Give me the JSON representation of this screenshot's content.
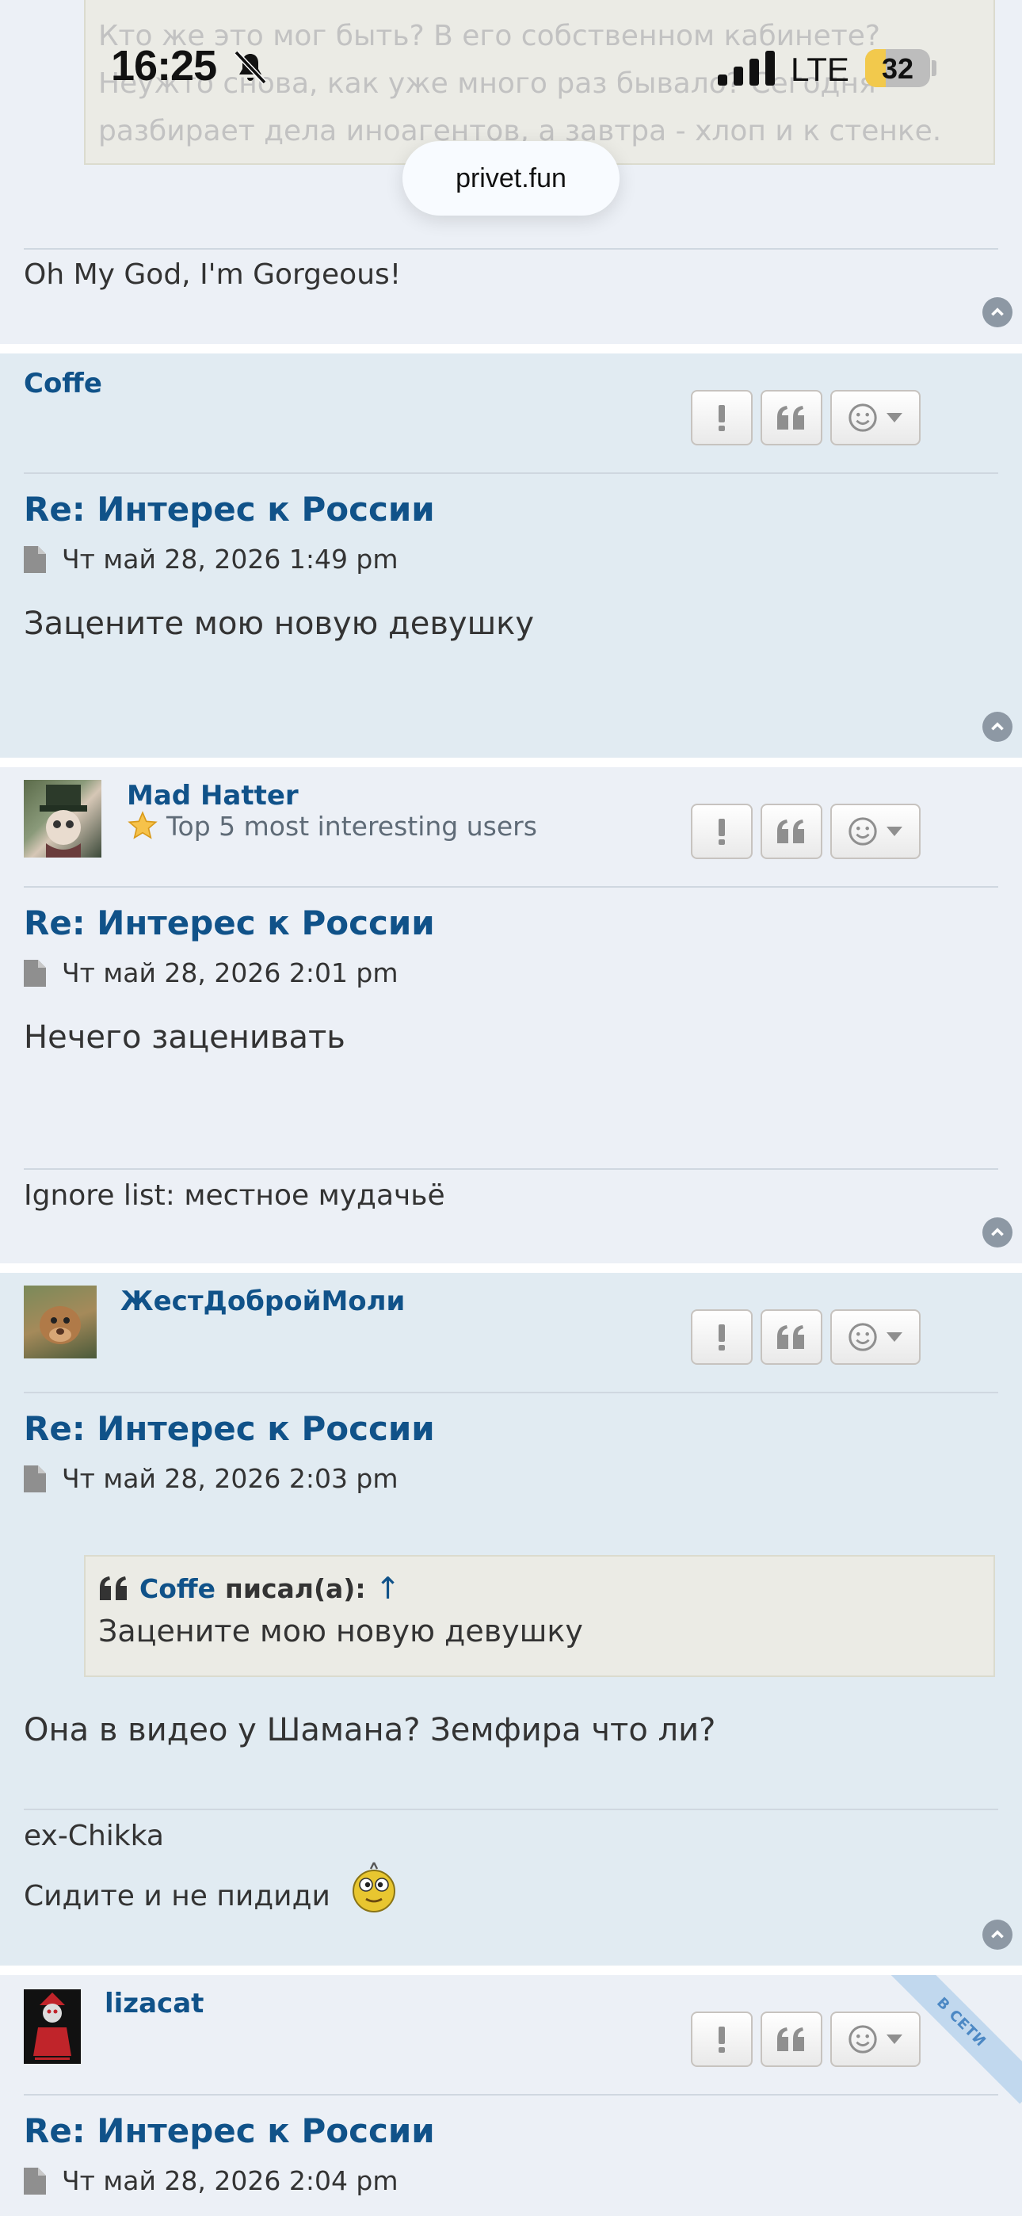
{
  "status_bar": {
    "time": "16:25",
    "network": "LTE",
    "battery": "32",
    "battery_level": 0.32
  },
  "browser": {
    "url": "privet.fun"
  },
  "prev_post": {
    "quote_text": "Кто же это мог быть? В его собственном кабинете? Неужто снова, как уже много раз бывало? Сегодня разбирает дела иноагентов, а завтра - хлоп и к стенке.",
    "signature": "Oh My God, I'm Gorgeous!"
  },
  "posts": [
    {
      "author": "Coffe",
      "title": "Re: Интерес к России",
      "date": "Чт май 28, 2026 1:49 pm",
      "body": "Зацените мою новую девушку"
    },
    {
      "author": "Mad Hatter",
      "rank": "Top 5 most interesting users",
      "title": "Re: Интерес к России",
      "date": "Чт май 28, 2026 2:01 pm",
      "body": "Нечего заценивать",
      "signature": "Ignore list: местное мудачьё"
    },
    {
      "author": "ЖестДобройМоли",
      "title": "Re: Интерес к России",
      "date": "Чт май 28, 2026 2:03 pm",
      "quote": {
        "author": "Coffe",
        "wrote": "писал(а):",
        "arrow": "↑",
        "text": "Зацените мою новую девушку"
      },
      "body": "Она в видео у Шамана? Земфира что ли?",
      "signature_line1": "ex-Chikka",
      "signature_line2": "Сидите и не пидиди"
    },
    {
      "author": "lizacat",
      "online_badge": "В СЕТИ",
      "title": "Re: Интерес к России",
      "date": "Чт май 28, 2026 2:04 pm"
    }
  ],
  "icons": {
    "report": "exclamation-icon",
    "quote": "quote-icon",
    "reaction": "smiley-icon",
    "top": "chevron-up-icon",
    "post": "document-icon"
  },
  "colors": {
    "link": "#105289",
    "post_bg_1": "#ecf0f6",
    "post_bg_2": "#e1ebf2"
  }
}
